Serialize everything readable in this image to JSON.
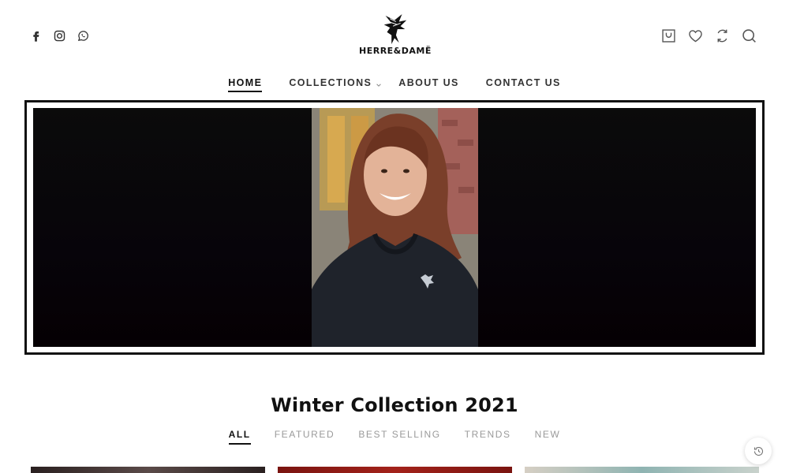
{
  "header": {
    "brand": "HERRE&DAMË",
    "social_icons": [
      "facebook-icon",
      "instagram-icon",
      "whatsapp-icon"
    ],
    "action_icons": [
      "cart-icon",
      "wishlist-icon",
      "compare-icon",
      "search-icon"
    ]
  },
  "nav": {
    "items": [
      {
        "label": "HOME",
        "active": true
      },
      {
        "label": "COLLECTIONS",
        "has_dropdown": true
      },
      {
        "label": "ABOUT US"
      },
      {
        "label": "CONTACT US"
      }
    ]
  },
  "section": {
    "title": "Winter Collection 2021",
    "filters": [
      {
        "label": "ALL",
        "active": true
      },
      {
        "label": "FEATURED"
      },
      {
        "label": "BEST SELLING"
      },
      {
        "label": "TRENDS"
      },
      {
        "label": "NEW"
      }
    ]
  },
  "floating": {
    "icon": "history-icon"
  },
  "colors": {
    "accent": "#111111",
    "muted": "#9a9a9a",
    "hero_bg": "#0b0b0b"
  }
}
